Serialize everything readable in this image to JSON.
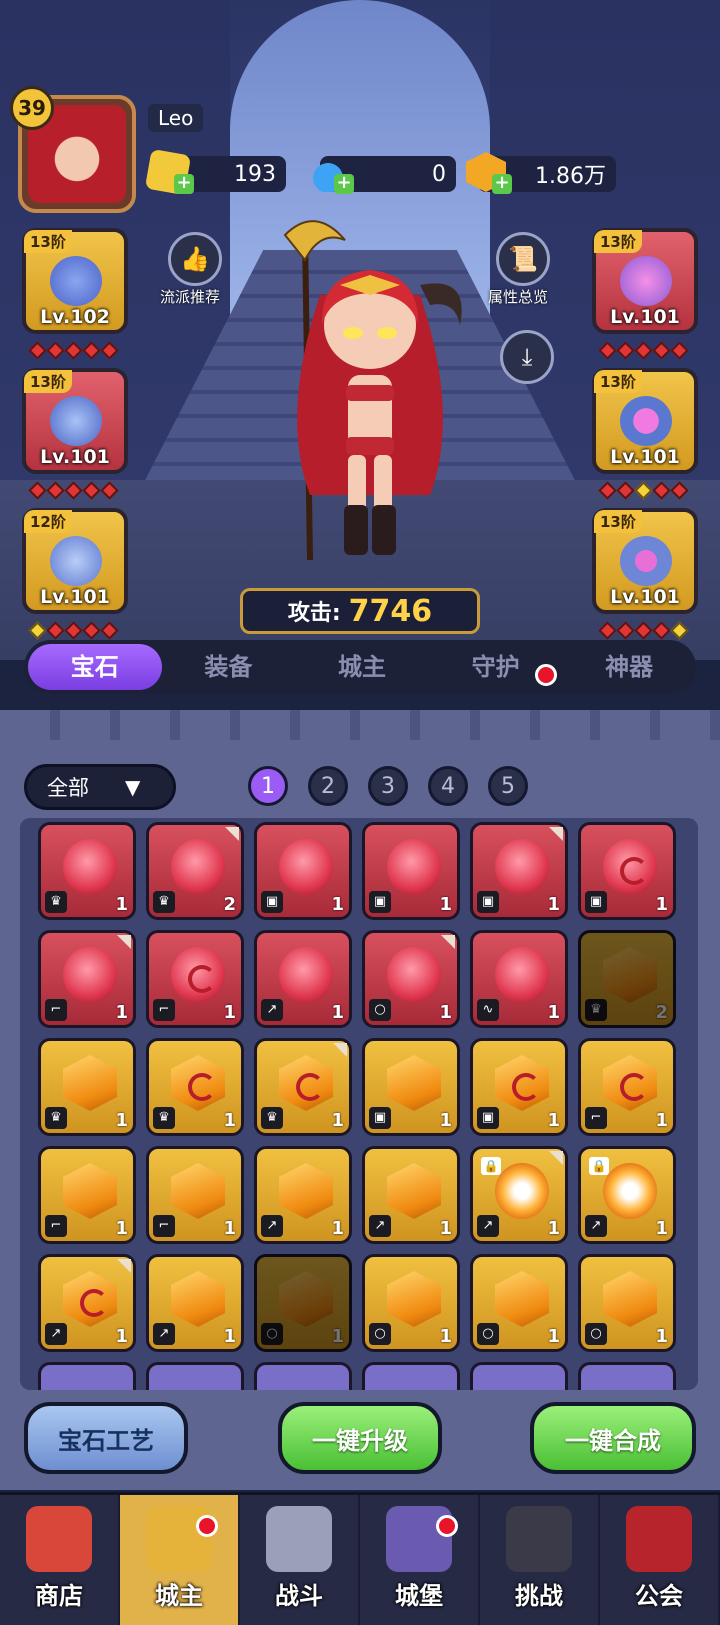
{
  "player": {
    "level": "39",
    "name": "Leo"
  },
  "resources": [
    {
      "icon": "gold-cube-icon",
      "value": "193"
    },
    {
      "icon": "blue-potion-icon",
      "value": "0"
    },
    {
      "icon": "gold-coin-icon",
      "value": "1.86万"
    }
  ],
  "left_equipment": [
    {
      "icon": "wizard-hat-icon",
      "tier": "13阶",
      "level": "Lv.102",
      "color": "gold"
    },
    {
      "icon": "robe-armor-icon",
      "tier": "13阶",
      "level": "Lv.101",
      "color": "red"
    },
    {
      "icon": "boots-icon",
      "tier": "12阶",
      "level": "Lv.101",
      "color": "gold"
    }
  ],
  "right_equipment": [
    {
      "icon": "scepter-icon",
      "tier": "13阶",
      "level": "Lv.101",
      "color": "red"
    },
    {
      "icon": "ring-icon",
      "tier": "13阶",
      "level": "Lv.101",
      "color": "gold"
    },
    {
      "icon": "amulet-icon",
      "tier": "13阶",
      "level": "Lv.101",
      "color": "gold"
    }
  ],
  "side_buttons": {
    "build_recommend": "流派推荐",
    "attribute_overview": "属性总览"
  },
  "attack": {
    "label": "攻击:",
    "value": "7746"
  },
  "tabs": [
    "宝石",
    "装备",
    "城主",
    "守护",
    "神器"
  ],
  "filter": {
    "label": "全部"
  },
  "pages": [
    "1",
    "2",
    "3",
    "4",
    "5"
  ],
  "gems": [
    {
      "type": "ruby",
      "slot": "crown",
      "count": "1"
    },
    {
      "type": "ruby",
      "slot": "crown",
      "count": "2"
    },
    {
      "type": "ruby",
      "slot": "armor",
      "count": "1"
    },
    {
      "type": "ruby",
      "slot": "armor",
      "count": "1"
    },
    {
      "type": "ruby",
      "slot": "armor",
      "count": "1"
    },
    {
      "type": "ruby-spiral",
      "slot": "armor",
      "count": "1"
    },
    {
      "type": "ruby",
      "slot": "boot",
      "count": "1"
    },
    {
      "type": "ruby-spiral",
      "slot": "boot",
      "count": "1"
    },
    {
      "type": "ruby",
      "slot": "weapon",
      "count": "1"
    },
    {
      "type": "ruby",
      "slot": "ring",
      "count": "1"
    },
    {
      "type": "ruby",
      "slot": "amulet",
      "count": "1"
    },
    {
      "type": "topaz-dim",
      "slot": "crown",
      "count": "2"
    },
    {
      "type": "topaz",
      "slot": "crown",
      "count": "1"
    },
    {
      "type": "topaz-spiral",
      "slot": "crown",
      "count": "1"
    },
    {
      "type": "topaz-spiral",
      "slot": "crown",
      "count": "1"
    },
    {
      "type": "topaz",
      "slot": "armor",
      "count": "1"
    },
    {
      "type": "topaz-spiral",
      "slot": "armor",
      "count": "1"
    },
    {
      "type": "topaz-spiral",
      "slot": "boot",
      "count": "1"
    },
    {
      "type": "topaz",
      "slot": "boot",
      "count": "1"
    },
    {
      "type": "topaz",
      "slot": "boot",
      "count": "1"
    },
    {
      "type": "topaz",
      "slot": "weapon",
      "count": "1"
    },
    {
      "type": "topaz",
      "slot": "weapon",
      "count": "1"
    },
    {
      "type": "topaz-glow",
      "slot": "weapon",
      "count": "1"
    },
    {
      "type": "topaz-glow",
      "slot": "weapon",
      "count": "1"
    },
    {
      "type": "topaz-spiral",
      "slot": "weapon",
      "count": "1"
    },
    {
      "type": "topaz",
      "slot": "weapon",
      "count": "1"
    },
    {
      "type": "topaz-dim",
      "slot": "ring",
      "count": "1"
    },
    {
      "type": "topaz",
      "slot": "ring",
      "count": "1"
    },
    {
      "type": "topaz",
      "slot": "ring",
      "count": "1"
    },
    {
      "type": "topaz",
      "slot": "ring",
      "count": "1"
    }
  ],
  "actions": {
    "craft": "宝石工艺",
    "upgrade_all": "一键升级",
    "merge_all": "一键合成"
  },
  "nav": [
    {
      "label": "商店",
      "icon": "shop-icon",
      "active": false,
      "dot": false
    },
    {
      "label": "城主",
      "icon": "crown-icon",
      "active": true,
      "dot": true
    },
    {
      "label": "战斗",
      "icon": "crossed-swords-icon",
      "active": false,
      "dot": false
    },
    {
      "label": "城堡",
      "icon": "castle-icon",
      "active": false,
      "dot": true
    },
    {
      "label": "挑战",
      "icon": "demon-helmet-icon",
      "active": false,
      "dot": false
    },
    {
      "label": "公会",
      "icon": "guild-banner-icon",
      "active": false,
      "dot": false
    }
  ]
}
